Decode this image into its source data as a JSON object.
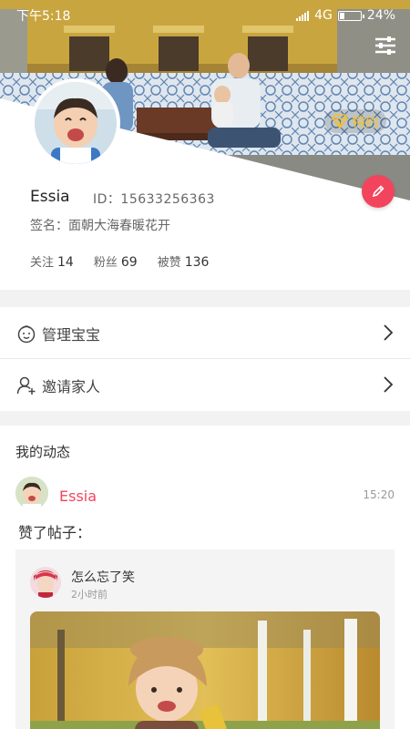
{
  "status_bar": {
    "time": "下午5:18",
    "network": "4G",
    "battery": "24%"
  },
  "header": {
    "badge_label": "特约",
    "menu_icon": "sliders-icon",
    "edit_icon": "pencil-icon",
    "colors": {
      "accent": "#f2445c",
      "badge": "#f3c12c"
    }
  },
  "profile": {
    "name": "Essia",
    "id_text": "ID：15633256363",
    "signature": "签名：面朝大海春暖花开",
    "stats": [
      {
        "label": "关注",
        "value": "14"
      },
      {
        "label": "粉丝",
        "value": "69"
      },
      {
        "label": "被赞",
        "value": "136"
      }
    ]
  },
  "menu": [
    {
      "label": "管理宝宝",
      "icon": "baby-face-icon"
    },
    {
      "label": "邀请家人",
      "icon": "add-user-icon"
    }
  ],
  "feed": {
    "title": "我的动态",
    "post": {
      "author": "Essia",
      "time": "15:20",
      "action": "赞了帖子：",
      "card": {
        "title": "怎么忘了笑",
        "time": "2小时前"
      }
    }
  }
}
